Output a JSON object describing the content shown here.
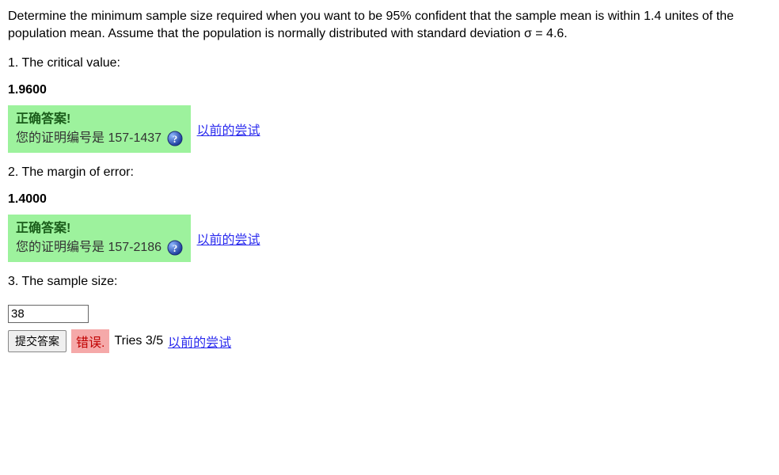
{
  "problem": {
    "statement": "Determine the minimum sample size required when you want to be 95% confident that the sample mean is within 1.4 unites of the population mean. Assume that the population is normally distributed with standard deviation σ = 4.6."
  },
  "questions": {
    "q1": {
      "label": "1. The critical value:",
      "answer": "1.9600",
      "feedback": {
        "title": "正确答案!",
        "receipt_prefix": "您的证明编号是 ",
        "receipt_number": "157-1437"
      },
      "prev_attempts_label": "以前的尝试"
    },
    "q2": {
      "label": "2. The margin of error:",
      "answer": "1.4000",
      "feedback": {
        "title": "正确答案!",
        "receipt_prefix": "您的证明编号是 ",
        "receipt_number": "157-2186"
      },
      "prev_attempts_label": "以前的尝试"
    },
    "q3": {
      "label": "3. The sample size:",
      "input_value": "38",
      "submit_label": "提交答案",
      "error_label": "错误.",
      "tries_label": "Tries 3/5",
      "prev_attempts_label": "以前的尝试"
    }
  }
}
